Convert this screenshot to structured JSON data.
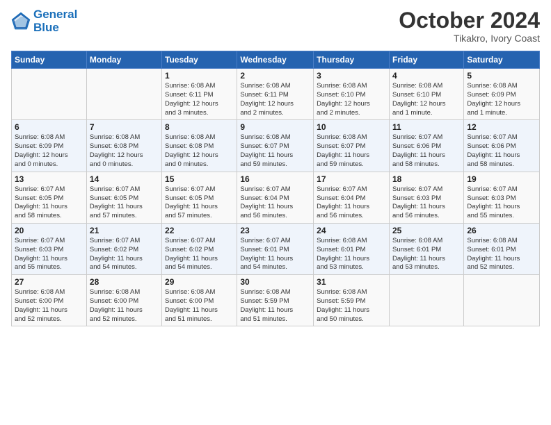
{
  "logo": {
    "line1": "General",
    "line2": "Blue"
  },
  "title": "October 2024",
  "subtitle": "Tikakro, Ivory Coast",
  "weekdays": [
    "Sunday",
    "Monday",
    "Tuesday",
    "Wednesday",
    "Thursday",
    "Friday",
    "Saturday"
  ],
  "weeks": [
    [
      {
        "day": "",
        "info": ""
      },
      {
        "day": "",
        "info": ""
      },
      {
        "day": "1",
        "info": "Sunrise: 6:08 AM\nSunset: 6:11 PM\nDaylight: 12 hours\nand 3 minutes."
      },
      {
        "day": "2",
        "info": "Sunrise: 6:08 AM\nSunset: 6:11 PM\nDaylight: 12 hours\nand 2 minutes."
      },
      {
        "day": "3",
        "info": "Sunrise: 6:08 AM\nSunset: 6:10 PM\nDaylight: 12 hours\nand 2 minutes."
      },
      {
        "day": "4",
        "info": "Sunrise: 6:08 AM\nSunset: 6:10 PM\nDaylight: 12 hours\nand 1 minute."
      },
      {
        "day": "5",
        "info": "Sunrise: 6:08 AM\nSunset: 6:09 PM\nDaylight: 12 hours\nand 1 minute."
      }
    ],
    [
      {
        "day": "6",
        "info": "Sunrise: 6:08 AM\nSunset: 6:09 PM\nDaylight: 12 hours\nand 0 minutes."
      },
      {
        "day": "7",
        "info": "Sunrise: 6:08 AM\nSunset: 6:08 PM\nDaylight: 12 hours\nand 0 minutes."
      },
      {
        "day": "8",
        "info": "Sunrise: 6:08 AM\nSunset: 6:08 PM\nDaylight: 12 hours\nand 0 minutes."
      },
      {
        "day": "9",
        "info": "Sunrise: 6:08 AM\nSunset: 6:07 PM\nDaylight: 11 hours\nand 59 minutes."
      },
      {
        "day": "10",
        "info": "Sunrise: 6:08 AM\nSunset: 6:07 PM\nDaylight: 11 hours\nand 59 minutes."
      },
      {
        "day": "11",
        "info": "Sunrise: 6:07 AM\nSunset: 6:06 PM\nDaylight: 11 hours\nand 58 minutes."
      },
      {
        "day": "12",
        "info": "Sunrise: 6:07 AM\nSunset: 6:06 PM\nDaylight: 11 hours\nand 58 minutes."
      }
    ],
    [
      {
        "day": "13",
        "info": "Sunrise: 6:07 AM\nSunset: 6:05 PM\nDaylight: 11 hours\nand 58 minutes."
      },
      {
        "day": "14",
        "info": "Sunrise: 6:07 AM\nSunset: 6:05 PM\nDaylight: 11 hours\nand 57 minutes."
      },
      {
        "day": "15",
        "info": "Sunrise: 6:07 AM\nSunset: 6:05 PM\nDaylight: 11 hours\nand 57 minutes."
      },
      {
        "day": "16",
        "info": "Sunrise: 6:07 AM\nSunset: 6:04 PM\nDaylight: 11 hours\nand 56 minutes."
      },
      {
        "day": "17",
        "info": "Sunrise: 6:07 AM\nSunset: 6:04 PM\nDaylight: 11 hours\nand 56 minutes."
      },
      {
        "day": "18",
        "info": "Sunrise: 6:07 AM\nSunset: 6:03 PM\nDaylight: 11 hours\nand 56 minutes."
      },
      {
        "day": "19",
        "info": "Sunrise: 6:07 AM\nSunset: 6:03 PM\nDaylight: 11 hours\nand 55 minutes."
      }
    ],
    [
      {
        "day": "20",
        "info": "Sunrise: 6:07 AM\nSunset: 6:03 PM\nDaylight: 11 hours\nand 55 minutes."
      },
      {
        "day": "21",
        "info": "Sunrise: 6:07 AM\nSunset: 6:02 PM\nDaylight: 11 hours\nand 54 minutes."
      },
      {
        "day": "22",
        "info": "Sunrise: 6:07 AM\nSunset: 6:02 PM\nDaylight: 11 hours\nand 54 minutes."
      },
      {
        "day": "23",
        "info": "Sunrise: 6:07 AM\nSunset: 6:01 PM\nDaylight: 11 hours\nand 54 minutes."
      },
      {
        "day": "24",
        "info": "Sunrise: 6:08 AM\nSunset: 6:01 PM\nDaylight: 11 hours\nand 53 minutes."
      },
      {
        "day": "25",
        "info": "Sunrise: 6:08 AM\nSunset: 6:01 PM\nDaylight: 11 hours\nand 53 minutes."
      },
      {
        "day": "26",
        "info": "Sunrise: 6:08 AM\nSunset: 6:01 PM\nDaylight: 11 hours\nand 52 minutes."
      }
    ],
    [
      {
        "day": "27",
        "info": "Sunrise: 6:08 AM\nSunset: 6:00 PM\nDaylight: 11 hours\nand 52 minutes."
      },
      {
        "day": "28",
        "info": "Sunrise: 6:08 AM\nSunset: 6:00 PM\nDaylight: 11 hours\nand 52 minutes."
      },
      {
        "day": "29",
        "info": "Sunrise: 6:08 AM\nSunset: 6:00 PM\nDaylight: 11 hours\nand 51 minutes."
      },
      {
        "day": "30",
        "info": "Sunrise: 6:08 AM\nSunset: 5:59 PM\nDaylight: 11 hours\nand 51 minutes."
      },
      {
        "day": "31",
        "info": "Sunrise: 6:08 AM\nSunset: 5:59 PM\nDaylight: 11 hours\nand 50 minutes."
      },
      {
        "day": "",
        "info": ""
      },
      {
        "day": "",
        "info": ""
      }
    ]
  ]
}
